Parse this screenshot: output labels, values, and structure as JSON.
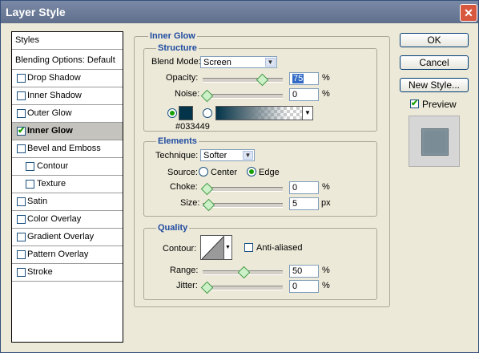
{
  "window": {
    "title": "Layer Style"
  },
  "sidebar": {
    "items": [
      {
        "label": "Styles",
        "checkbox": false
      },
      {
        "label": "Blending Options: Default",
        "checkbox": false
      },
      {
        "label": "Drop Shadow",
        "checkbox": true,
        "checked": false
      },
      {
        "label": "Inner Shadow",
        "checkbox": true,
        "checked": false
      },
      {
        "label": "Outer Glow",
        "checkbox": true,
        "checked": false
      },
      {
        "label": "Inner Glow",
        "checkbox": true,
        "checked": true,
        "selected": true
      },
      {
        "label": "Bevel and Emboss",
        "checkbox": true,
        "checked": false
      },
      {
        "label": "Contour",
        "checkbox": true,
        "checked": false,
        "indent": true
      },
      {
        "label": "Texture",
        "checkbox": true,
        "checked": false,
        "indent": true
      },
      {
        "label": "Satin",
        "checkbox": true,
        "checked": false
      },
      {
        "label": "Color Overlay",
        "checkbox": true,
        "checked": false
      },
      {
        "label": "Gradient Overlay",
        "checkbox": true,
        "checked": false
      },
      {
        "label": "Pattern Overlay",
        "checkbox": true,
        "checked": false
      },
      {
        "label": "Stroke",
        "checkbox": true,
        "checked": false
      }
    ]
  },
  "inner_glow": {
    "title": "Inner Glow",
    "structure": {
      "title": "Structure",
      "blend_mode_label": "Blend Mode:",
      "blend_mode_value": "Screen",
      "opacity_label": "Opacity:",
      "opacity_value": "75",
      "opacity_percent": 75,
      "opacity_unit": "%",
      "noise_label": "Noise:",
      "noise_value": "0",
      "noise_percent": 0,
      "noise_unit": "%",
      "color_swatch": "#033449",
      "color_caption": "#033449"
    },
    "elements": {
      "title": "Elements",
      "technique_label": "Technique:",
      "technique_value": "Softer",
      "source_label": "Source:",
      "source_center": "Center",
      "source_edge": "Edge",
      "choke_label": "Choke:",
      "choke_value": "0",
      "choke_percent": 0,
      "choke_unit": "%",
      "size_label": "Size:",
      "size_value": "5",
      "size_unit": "px"
    },
    "quality": {
      "title": "Quality",
      "contour_label": "Contour:",
      "anti_aliased_label": "Anti-aliased",
      "range_label": "Range:",
      "range_value": "50",
      "range_percent": 50,
      "range_unit": "%",
      "jitter_label": "Jitter:",
      "jitter_value": "0",
      "jitter_percent": 0,
      "jitter_unit": "%"
    }
  },
  "actions": {
    "ok": "OK",
    "cancel": "Cancel",
    "new_style": "New Style...",
    "preview_label": "Preview"
  },
  "colors": {
    "accent": "#1f4ba0",
    "swatch": "#033449"
  }
}
